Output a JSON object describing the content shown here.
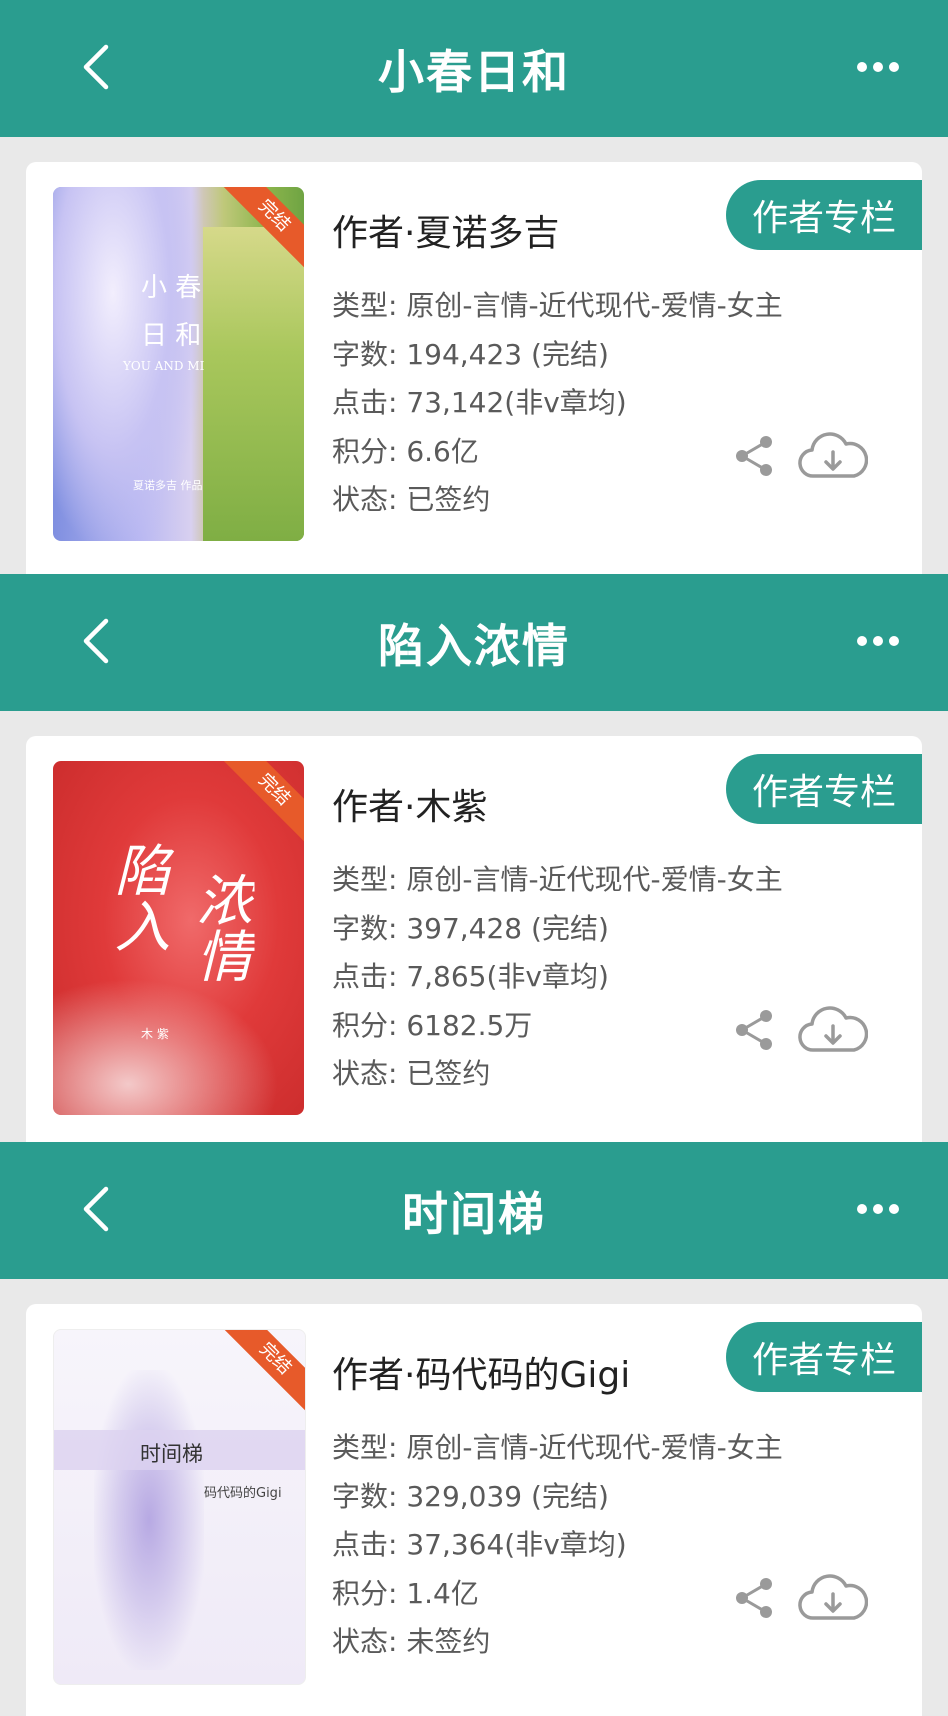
{
  "books": [
    {
      "title": "小春日和",
      "author": "作者·夏诺多吉",
      "column_label": "作者专栏",
      "type": "类型: 原创-言情-近代现代-爱情-女主",
      "words": "字数: 194,423 (完结)",
      "clicks": "点击: 73,142(非v章均)",
      "score": "积分: 6.6亿",
      "status": "状态: 已签约",
      "badge": "完结",
      "cover_title_1": "小 春",
      "cover_title_2": "日 和",
      "cover_sub": "YOU AND MI",
      "cover_author": "夏诺多吉  作品"
    },
    {
      "title": "陷入浓情",
      "author": "作者·木紫",
      "column_label": "作者专栏",
      "type": "类型: 原创-言情-近代现代-爱情-女主",
      "words": "字数: 397,428 (完结)",
      "clicks": "点击: 7,865(非v章均)",
      "score": "积分: 6182.5万",
      "status": "状态: 已签约",
      "badge": "完结",
      "cover_title_1": "陷入",
      "cover_title_2": "浓情",
      "cover_author": "木 紫"
    },
    {
      "title": "时间梯",
      "author": "作者·码代码的Gigi",
      "column_label": "作者专栏",
      "type": "类型: 原创-言情-近代现代-爱情-女主",
      "words": "字数: 329,039 (完结)",
      "clicks": "点击: 37,364(非v章均)",
      "score": "积分: 1.4亿",
      "status": "状态: 未签约",
      "badge": "完结",
      "cover_title_1": "时间梯",
      "cover_author": "码代码的Gigi"
    }
  ],
  "colors": {
    "brand": "#2a9d8f",
    "badge": "#e75a2a"
  },
  "icons": [
    "back-arrow-icon",
    "more-dots-icon",
    "share-icon",
    "cloud-download-icon"
  ]
}
